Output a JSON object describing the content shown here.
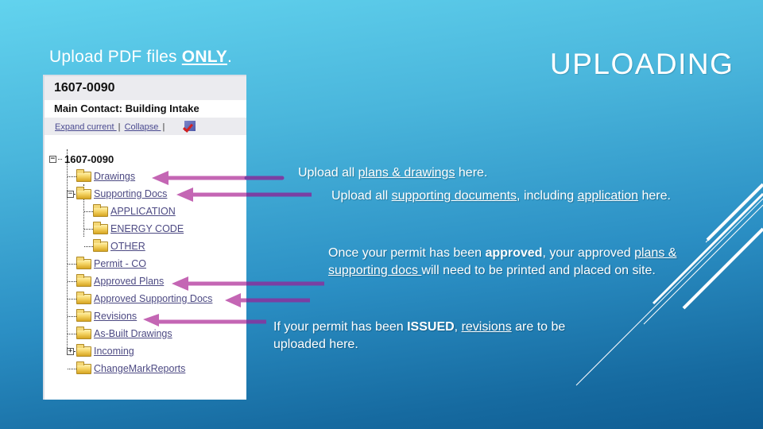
{
  "slide": {
    "title": "UPLOADING",
    "subtitle_prefix": "Upload PDF files ",
    "subtitle_emphasis": "ONLY",
    "subtitle_suffix": "."
  },
  "panel": {
    "permit_number": "1607-0090",
    "contact_label": "Main Contact:",
    "contact_value": "Building Intake",
    "expand_link": "Expand current ",
    "collapse_link": "Collapse ",
    "separator": "|",
    "check_icon": "checkmark-icon",
    "tree": {
      "root": "1607-0090",
      "root_toggle": "−",
      "items": [
        {
          "label": "Drawings",
          "level": 1
        },
        {
          "label": "Supporting Docs",
          "level": 1,
          "toggle": "−"
        },
        {
          "label": "APPLICATION",
          "level": 2
        },
        {
          "label": "ENERGY CODE",
          "level": 2
        },
        {
          "label": "OTHER",
          "level": 2
        },
        {
          "label": "Permit - CO",
          "level": 1
        },
        {
          "label": "Approved Plans",
          "level": 1
        },
        {
          "label": "Approved Supporting Docs",
          "level": 1
        },
        {
          "label": "Revisions",
          "level": 1
        },
        {
          "label": "As-Built Drawings",
          "level": 1
        },
        {
          "label": "Incoming",
          "level": 1,
          "toggle": "+"
        },
        {
          "label": "ChangeMarkReports",
          "level": 1
        }
      ]
    }
  },
  "notes": {
    "drawings": {
      "pre": "Upload all ",
      "link": "plans & drawings",
      "post": " here."
    },
    "supporting": {
      "pre": "Upload all ",
      "link": "supporting documents",
      "mid": ", including ",
      "link2": "application",
      "post": " here."
    },
    "approved": {
      "pre": "Once your permit has been ",
      "bold": "approved",
      "mid": ", your approved ",
      "link": "plans & supporting docs ",
      "post": "will need to be printed and placed on site."
    },
    "revisions": {
      "pre": "If your permit has been ",
      "bold": "ISSUED",
      "mid": ", ",
      "link": "revisions",
      "post": " are to be uploaded here."
    }
  },
  "colors": {
    "arrow": "#c466b4",
    "arrow_dark": "#7a3fa3"
  }
}
